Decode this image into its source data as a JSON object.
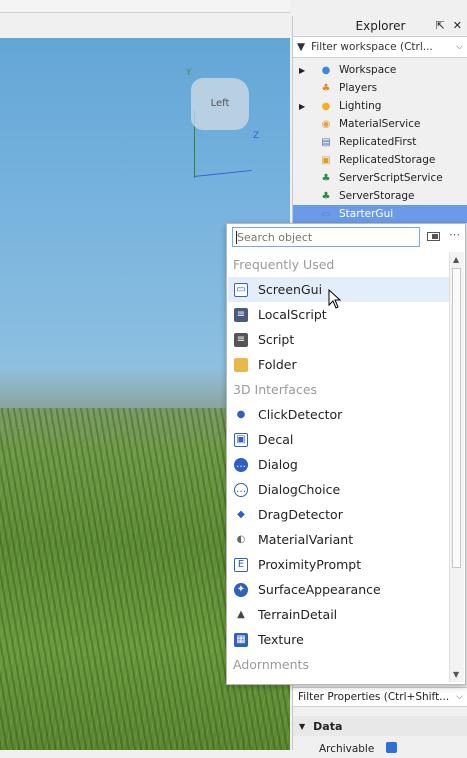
{
  "viewport": {
    "cube_face": "Left",
    "axis_y": "Y",
    "axis_z": "Z"
  },
  "explorer": {
    "title": "Explorer",
    "filter": "Filter workspace (Ctrl...",
    "items": [
      {
        "label": "Workspace",
        "icon": "globe-icon",
        "expandable": true,
        "color": "#3d8bd6"
      },
      {
        "label": "Players",
        "icon": "players-icon",
        "expandable": false,
        "color": "#e08b2b"
      },
      {
        "label": "Lighting",
        "icon": "lightbulb-icon",
        "expandable": true,
        "color": "#f0b020"
      },
      {
        "label": "MaterialService",
        "icon": "material-service-icon",
        "expandable": false,
        "color": "#e8a040"
      },
      {
        "label": "ReplicatedFirst",
        "icon": "replicated-first-icon",
        "expandable": false,
        "color": "#4a6fb0"
      },
      {
        "label": "ReplicatedStorage",
        "icon": "replicated-storage-icon",
        "expandable": false,
        "color": "#d8a030"
      },
      {
        "label": "ServerScriptService",
        "icon": "server-script-service-icon",
        "expandable": false,
        "color": "#2e8a4a"
      },
      {
        "label": "ServerStorage",
        "icon": "server-storage-icon",
        "expandable": false,
        "color": "#2e8a4a"
      },
      {
        "label": "StarterGui",
        "icon": "starter-gui-icon",
        "expandable": false,
        "color": "#5a7fc0",
        "selected": true
      }
    ],
    "props_filter": "Filter Properties (Ctrl+Shift...",
    "data_section": "Data",
    "first_prop": "Archivable"
  },
  "popup": {
    "search_placeholder": "Search object",
    "groups": [
      {
        "title": "Frequently Used",
        "items": [
          {
            "label": "ScreenGui",
            "icon": "screen-gui-icon",
            "hover": true
          },
          {
            "label": "LocalScript",
            "icon": "local-script-icon"
          },
          {
            "label": "Script",
            "icon": "script-icon"
          },
          {
            "label": "Folder",
            "icon": "folder-icon"
          }
        ]
      },
      {
        "title": "3D Interfaces",
        "items": [
          {
            "label": "ClickDetector",
            "icon": "click-detector-icon"
          },
          {
            "label": "Decal",
            "icon": "decal-icon"
          },
          {
            "label": "Dialog",
            "icon": "dialog-icon"
          },
          {
            "label": "DialogChoice",
            "icon": "dialog-choice-icon"
          },
          {
            "label": "DragDetector",
            "icon": "drag-detector-icon"
          },
          {
            "label": "MaterialVariant",
            "icon": "material-variant-icon"
          },
          {
            "label": "ProximityPrompt",
            "icon": "proximity-prompt-icon"
          },
          {
            "label": "SurfaceAppearance",
            "icon": "surface-appearance-icon"
          },
          {
            "label": "TerrainDetail",
            "icon": "terrain-detail-icon"
          },
          {
            "label": "Texture",
            "icon": "texture-icon"
          }
        ]
      },
      {
        "title": "Adornments",
        "items": []
      }
    ]
  }
}
